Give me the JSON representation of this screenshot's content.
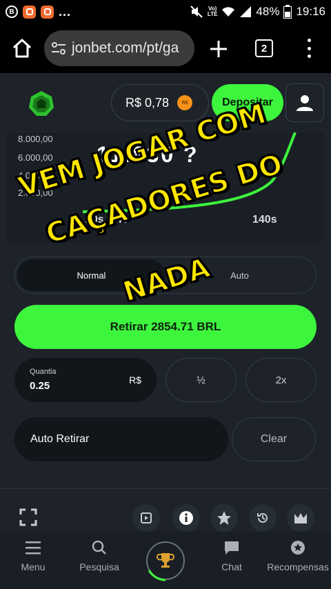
{
  "status_bar": {
    "notification_badge": "B",
    "more": "...",
    "volte": "Vo)",
    "lte": "LTE",
    "battery": "48%",
    "time": "19:16"
  },
  "browser": {
    "url": "jonbet.com/pt/ga",
    "tab_count": "2"
  },
  "header": {
    "balance": "R$ 0,78",
    "currency_badge": "R$",
    "deposit_label": "Depositar"
  },
  "game": {
    "multiplier": "11.830 ?",
    "y_labels": [
      "8.000,00",
      "6.000,00",
      "4.000,00",
      "2.000,00"
    ],
    "x_labels": [
      "20s",
      "40",
      "140s"
    ]
  },
  "overlay": {
    "line1": "VEM JOGAR COM",
    "line2": "CAÇADORES DO",
    "line3": "NADA"
  },
  "controls": {
    "mode_normal": "Normal",
    "mode_auto": "Auto",
    "cashout_label": "Retirar 2854.71 BRL",
    "amount_label": "Quantia",
    "amount_value": "0.25",
    "amount_currency": "R$",
    "half_label": "½",
    "double_label": "2x",
    "auto_cashout_label": "Auto Retirar",
    "clear_label": "Clear"
  },
  "nav": {
    "menu": "Menu",
    "search": "Pesquisa",
    "chat": "Chat",
    "rewards": "Recompensas"
  },
  "colors": {
    "accent_green": "#3df53d",
    "overlay_yellow": "#ffe600",
    "background": "#1d2329"
  }
}
